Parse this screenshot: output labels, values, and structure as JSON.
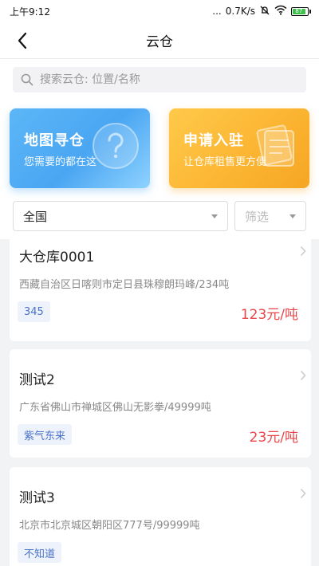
{
  "status_bar": {
    "time": "上午9:12",
    "dots": "...",
    "speed": "0.7K/s",
    "battery": "87"
  },
  "nav": {
    "title": "云仓"
  },
  "search": {
    "placeholder": "搜索云仓: 位置/名称",
    "value": ""
  },
  "banners": [
    {
      "title": "地图寻仓",
      "subtitle": "您需要的都在这",
      "deco_icon": "question-bubble-icon"
    },
    {
      "title": "申请入驻",
      "subtitle": "让仓库租售更方便",
      "deco_icon": "document-stack-icon"
    }
  ],
  "filters": {
    "region": "全国",
    "filter_placeholder": "筛选"
  },
  "warehouses": [
    {
      "name": "大仓库0001",
      "address": "西藏自治区日喀则市定日县珠穆朗玛峰/234吨",
      "tag": "345",
      "price": "123元/吨"
    },
    {
      "name": "测试2",
      "address": "广东省佛山市禅城区佛山无影拳/49999吨",
      "tag": "紫气东来",
      "price": "23元/吨"
    },
    {
      "name": "测试3",
      "address": "北京市北京城区朝阳区777号/99999吨",
      "tag": "不知道",
      "price": ""
    }
  ],
  "colors": {
    "accent_blue": "#4aa6f2",
    "accent_orange": "#fbb431",
    "price_red": "#e8464a",
    "tag_blue": "#4a72c8"
  }
}
